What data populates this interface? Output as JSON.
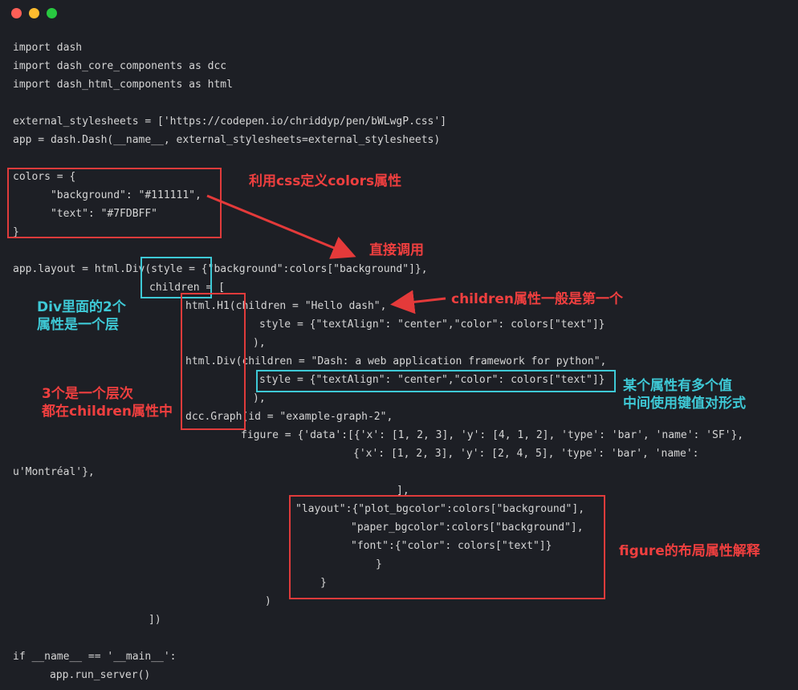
{
  "window": {
    "traffic_lights": [
      {
        "name": "close",
        "color": "#ff5f57"
      },
      {
        "name": "minimize",
        "color": "#febc2e"
      },
      {
        "name": "maximize",
        "color": "#28c840"
      }
    ]
  },
  "colors": {
    "background": "#1d1f25",
    "code_text": "#d5d5d5",
    "annotation_red": "#ef3f3f",
    "annotation_cyan": "#3ec9d6"
  },
  "code": {
    "l1": "import dash",
    "l2": "import dash_core_components as dcc",
    "l3": "import dash_html_components as html",
    "l4": "external_stylesheets = ['https://codepen.io/chriddyp/pen/bWLwgP.css']",
    "l5": "app = dash.Dash(__name__, external_stylesheets=external_stylesheets)",
    "l6": "colors = {",
    "l7": "      \"background\": \"#111111\",",
    "l8": "      \"text\": \"#7FDBFF\"",
    "l9": "}",
    "l10": "app.layout = html.Div(style = {\"background\":colors[\"background\"]},",
    "l11": "children = [",
    "l12": "html.H1(children = \"Hello dash\",",
    "l13": "style = {\"textAlign\": \"center\",\"color\": colors[\"text\"]}",
    "l14": "),",
    "l15": "html.Div(children = \"Dash: a web application framework for python\",",
    "l16": "style = {\"textAlign\": \"center\",\"color\": colors[\"text\"]}",
    "l17": "),",
    "l18": "dcc.Graph(id = \"example-graph-2\",",
    "l19": "figure = {'data':[{'x': [1, 2, 3], 'y': [4, 1, 2], 'type': 'bar', 'name': 'SF'},",
    "l20": "{'x': [1, 2, 3], 'y': [2, 4, 5], 'type': 'bar', 'name':",
    "l21": "u'Montréal'},",
    "l22": "],",
    "l23": "\"layout\":{\"plot_bgcolor\":colors[\"background\"],",
    "l24": "\"paper_bgcolor\":colors[\"background\"],",
    "l25": "\"font\":{\"color\": colors[\"text\"]}",
    "l26": "}",
    "l27": "}",
    "l28": ")",
    "l29": "])",
    "l30": "if __name__ == '__main__':",
    "l31": "app.run_server()"
  },
  "annotations": {
    "css_colors": "利用css定义colors属性",
    "direct_call": "直接调用",
    "children_first": "children属性一般是第一个",
    "div_two_attrs": "Div里面的2个\n属性是一个层",
    "three_levels": "3个是一个层次\n都在children属性中",
    "multi_values": "某个属性有多个值\n中间使用键值对形式",
    "figure_layout": "figure的布局属性解释"
  }
}
